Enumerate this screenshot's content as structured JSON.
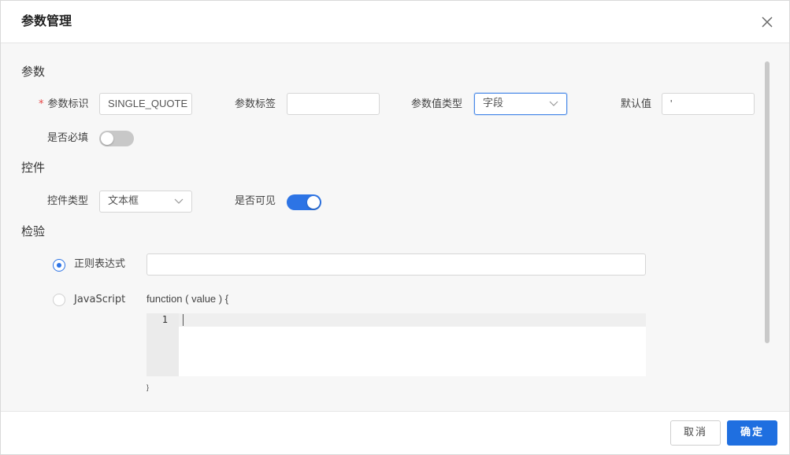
{
  "modal": {
    "title": "参数管理"
  },
  "sections": {
    "params": "参数",
    "control": "控件",
    "validation": "检验"
  },
  "params": {
    "id_label": "参数标识",
    "id_required_mark": "*",
    "id_value": "SINGLE_QUOTE",
    "tag_label": "参数标签",
    "tag_value": "",
    "value_type_label": "参数值类型",
    "value_type_selected": "字段",
    "default_label": "默认值",
    "default_value": "'",
    "required_label": "是否必填",
    "required_on": false
  },
  "control": {
    "type_label": "控件类型",
    "type_selected": "文本框",
    "visible_label": "是否可见",
    "visible_on": true
  },
  "validation": {
    "regex_label": "正则表达式",
    "regex_checked": true,
    "regex_value": "",
    "js_label": "JavaScript",
    "js_checked": false,
    "function_header": "function ( value ) {",
    "line_number": "1",
    "function_footer": "}"
  },
  "footer": {
    "cancel_label": "取消",
    "ok_label": "确定"
  },
  "colors": {
    "primary": "#1f6fe0",
    "switch_on": "#2d74e5",
    "switch_off": "#c8c8c8",
    "required": "#e64545"
  },
  "icons": {
    "close": "close-icon",
    "chevron": "chevron-down-icon"
  }
}
